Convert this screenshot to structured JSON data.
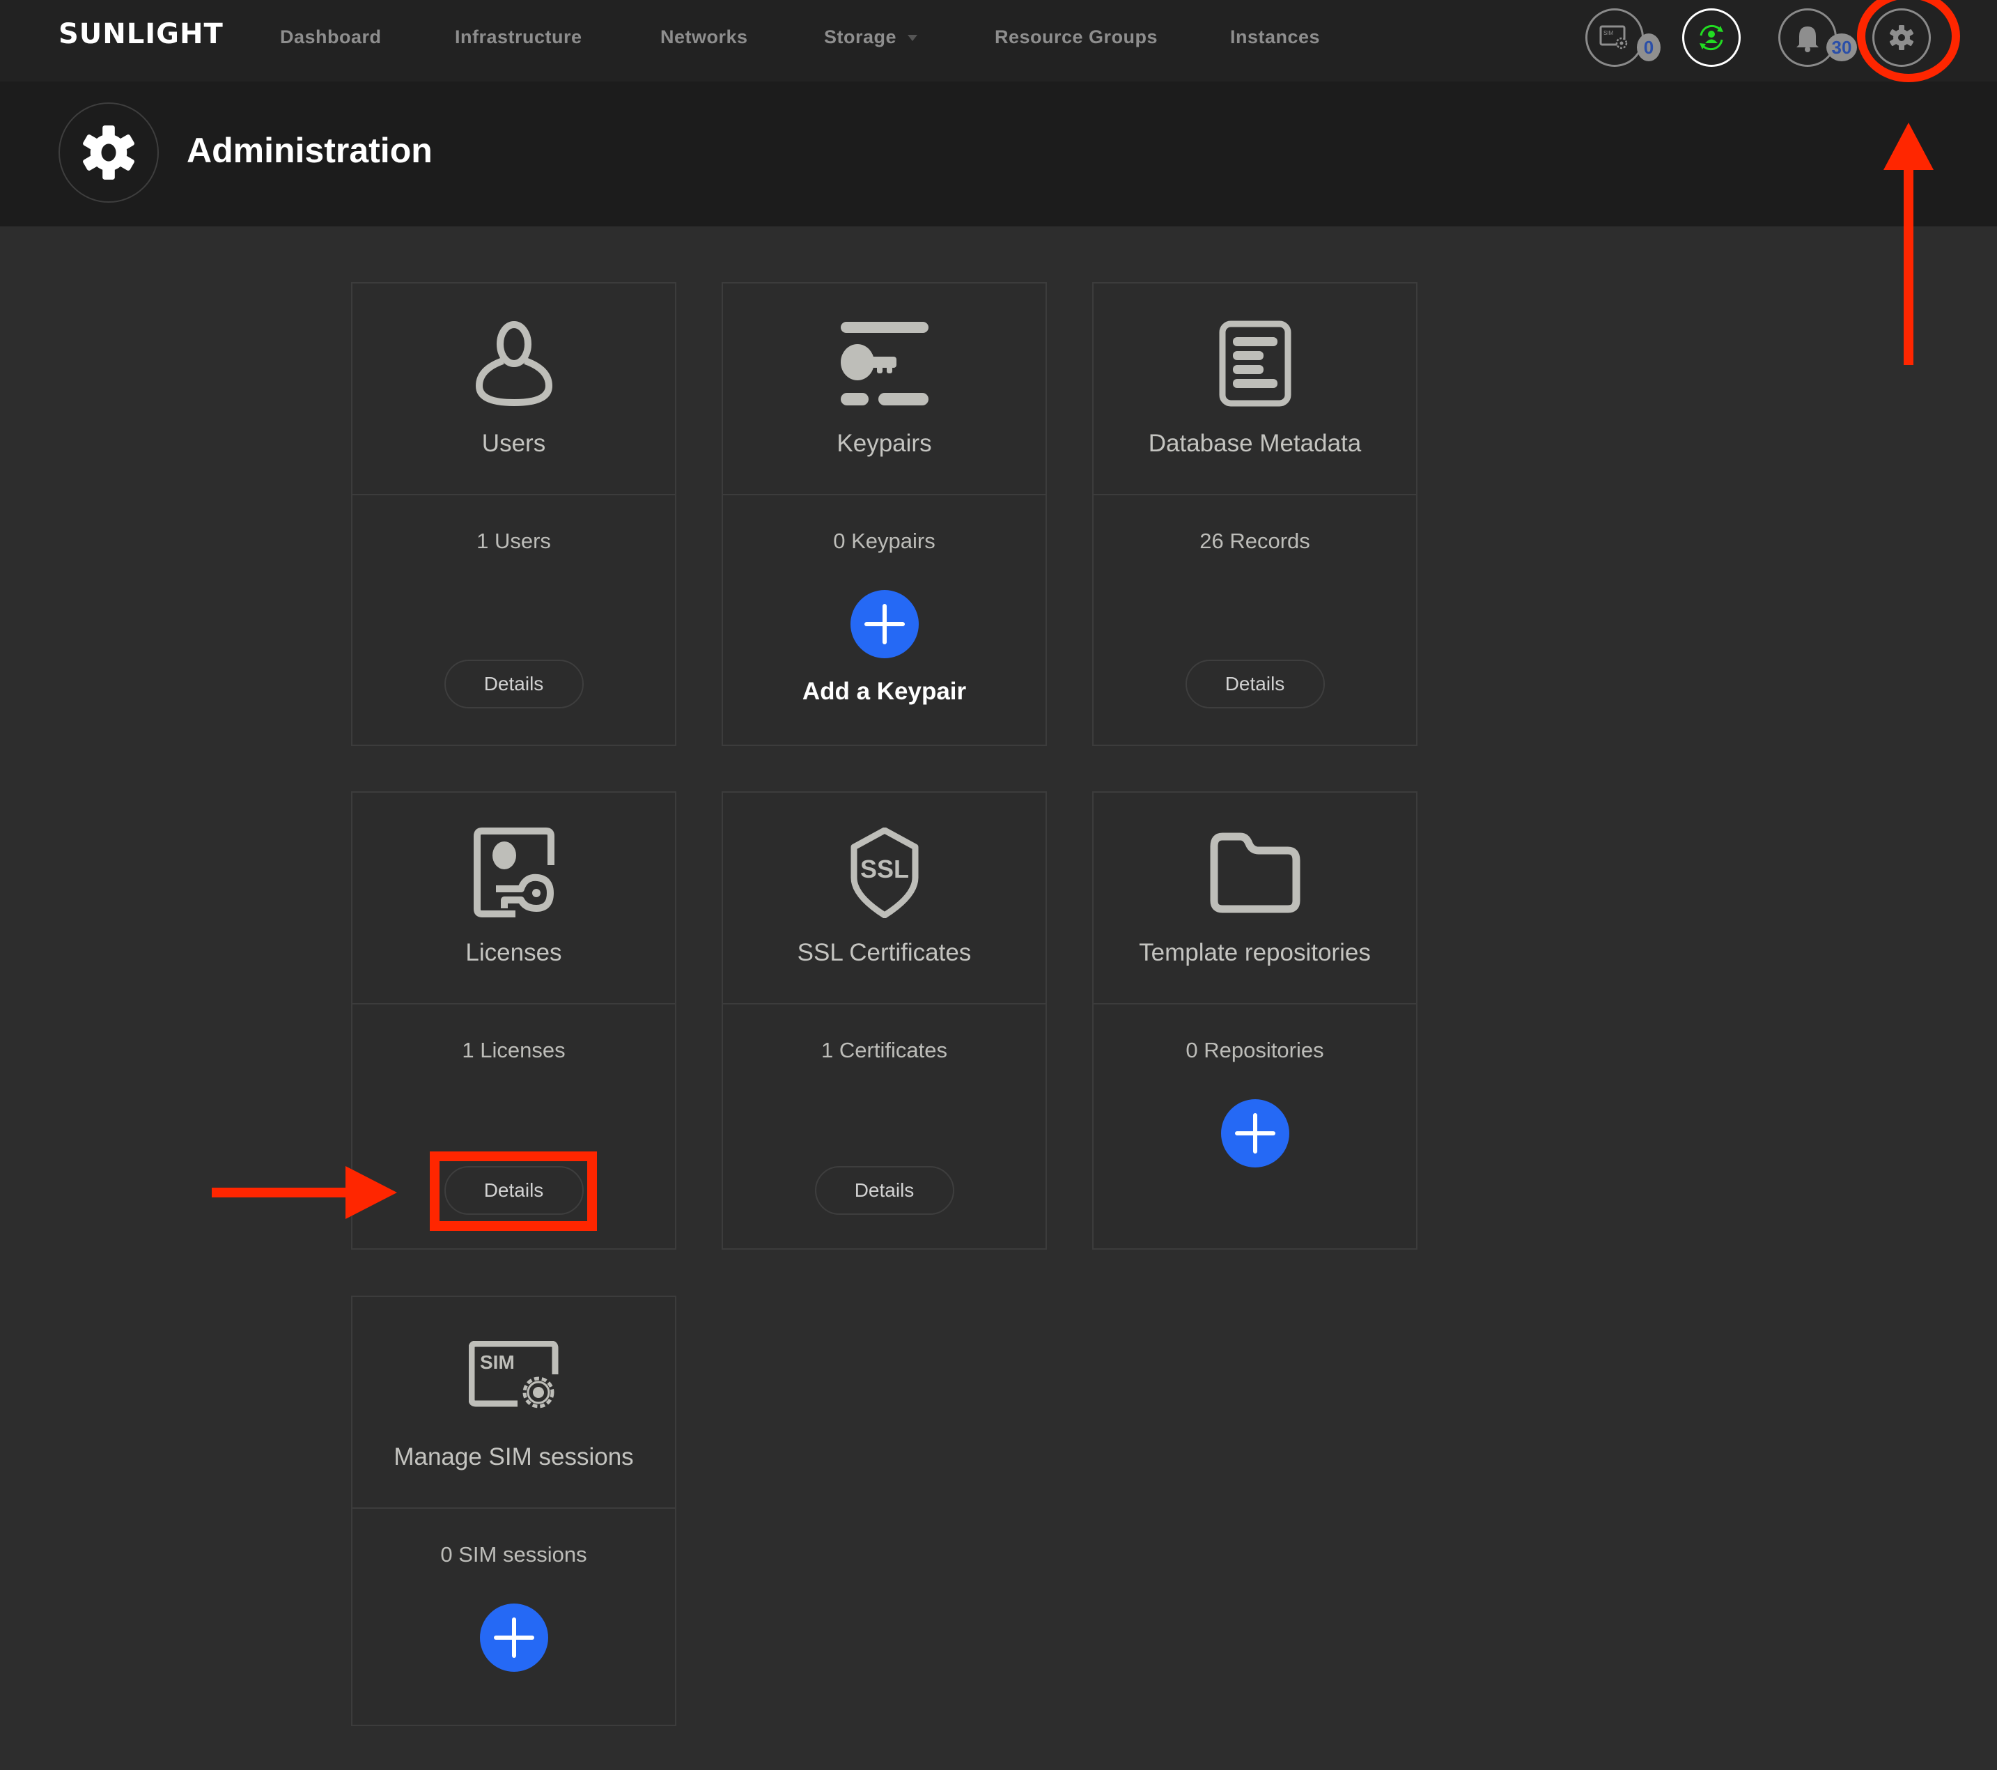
{
  "app": {
    "logo": "SUNLIGHT"
  },
  "nav": {
    "items": [
      {
        "label": "Dashboard"
      },
      {
        "label": "Infrastructure"
      },
      {
        "label": "Networks"
      },
      {
        "label": "Storage",
        "has_dropdown": true
      },
      {
        "label": "Resource Groups"
      },
      {
        "label": "Instances"
      }
    ],
    "right_icons": [
      {
        "name": "sim-sessions-icon",
        "badge": "0"
      },
      {
        "name": "user-sync-icon"
      },
      {
        "name": "notifications-bell-icon",
        "badge": "30"
      },
      {
        "name": "settings-gear-icon"
      }
    ]
  },
  "page": {
    "title": "Administration",
    "icon": "gear-icon"
  },
  "cards": [
    {
      "title": "Users",
      "icon": "user-icon",
      "count": "1 Users",
      "action": "Details"
    },
    {
      "title": "Keypairs",
      "icon": "keypair-icon",
      "count": "0 Keypairs",
      "action": "add",
      "add_label": "Add a Keypair"
    },
    {
      "title": "Database Metadata",
      "icon": "document-list-icon",
      "count": "26 Records",
      "action": "Details"
    },
    {
      "title": "Licenses",
      "icon": "license-key-icon",
      "count": "1 Licenses",
      "action": "Details"
    },
    {
      "title": "SSL Certificates",
      "icon": "ssl-shield-icon",
      "count": "1 Certificates",
      "action": "Details"
    },
    {
      "title": "Template repositories",
      "icon": "folder-icon",
      "count": "0 Repositories",
      "action": "add"
    },
    {
      "title": "Manage SIM sessions",
      "icon": "sim-gear-icon",
      "count": "0 SIM sessions",
      "action": "add"
    }
  ],
  "colors": {
    "accent_blue": "#2569f5",
    "annotation_red": "#ff2600",
    "sync_green": "#22dd22",
    "badge_text_blue": "#2b4fa8"
  }
}
